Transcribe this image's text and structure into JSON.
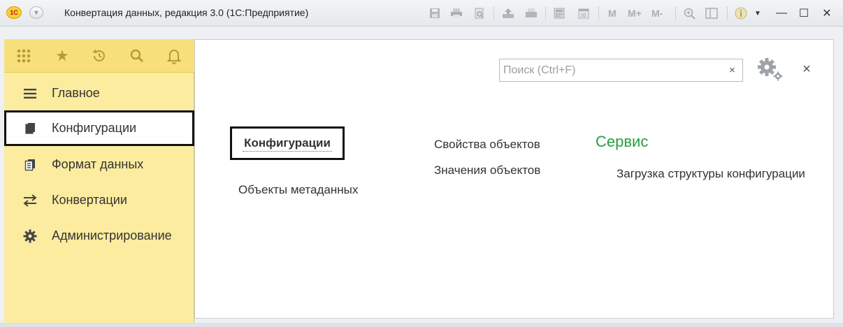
{
  "window": {
    "title": "Конвертация данных, редакция 3.0  (1С:Предприятие)",
    "logo_text": "1С",
    "toolbar_text_buttons": [
      "M",
      "M+",
      "M-"
    ],
    "controls": {
      "minimize": "—",
      "maximize": "☐",
      "close": "✕"
    }
  },
  "sidebar": {
    "items": [
      {
        "label": "Главное",
        "icon": "list-icon"
      },
      {
        "label": "Конфигурации",
        "icon": "documents-icon",
        "active": true
      },
      {
        "label": "Формат данных",
        "icon": "documents-grid-icon"
      },
      {
        "label": "Конвертации",
        "icon": "exchange-arrows-icon"
      },
      {
        "label": "Администрирование",
        "icon": "gear-icon"
      }
    ]
  },
  "main": {
    "search": {
      "placeholder": "Поиск (Ctrl+F)",
      "value": ""
    },
    "clear_label": "×",
    "close_label": "×",
    "active_group": "Конфигурации",
    "links_col1": [
      "Объекты метаданных"
    ],
    "links_col2": [
      "Свойства объектов",
      "Значения объектов"
    ],
    "service_title": "Сервис",
    "service_links": [
      "Загрузка структуры конфигурации"
    ]
  },
  "colors": {
    "sidebar_bg": "#fbec9f",
    "sidebar_top_bg": "#f7e07b",
    "section_title": "#2a9e43",
    "active_border": "#111111"
  }
}
